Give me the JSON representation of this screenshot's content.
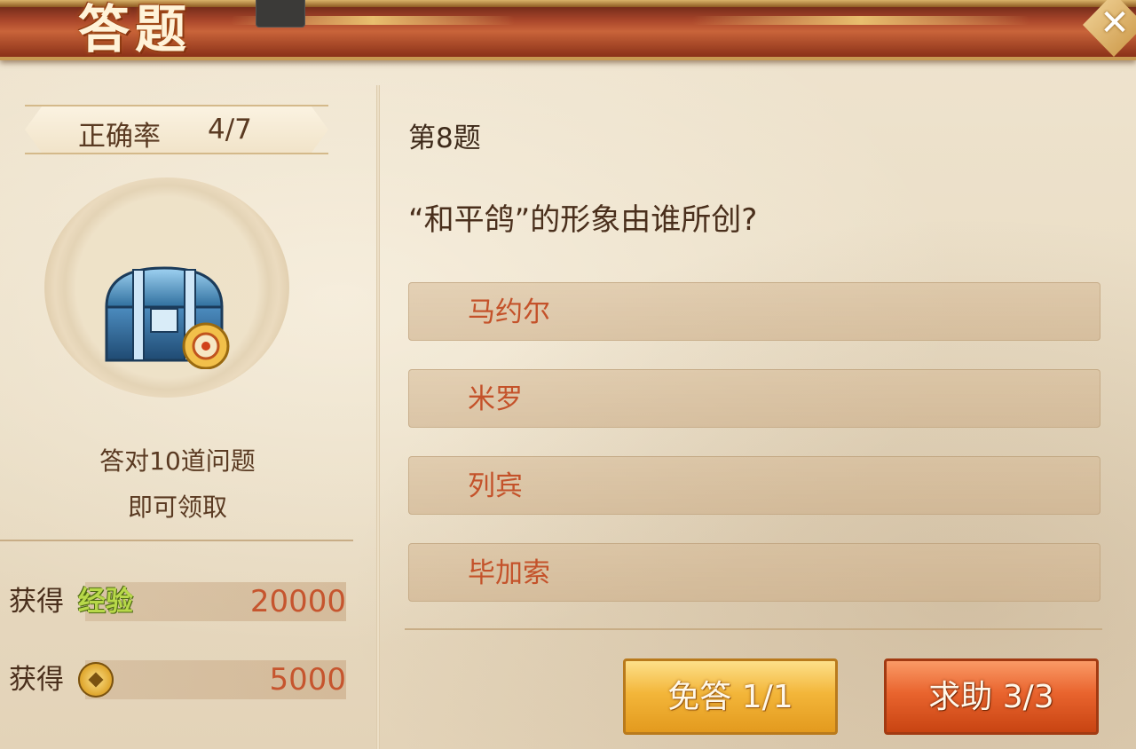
{
  "header": {
    "title": "答题",
    "close_icon": "close-icon"
  },
  "progress": {
    "label": "正确率",
    "value": "4/7"
  },
  "reward": {
    "chest_icon": "treasure-chest-icon",
    "line1": "答对10道问题",
    "line2": "即可领取"
  },
  "gains": [
    {
      "label": "获得",
      "type": "经验",
      "value": "20000"
    },
    {
      "label": "获得",
      "type_icon": "coin-icon",
      "value": "5000"
    }
  ],
  "question": {
    "number": "第8题",
    "text": "“和平鸽”的形象由谁所创?",
    "options": [
      "马约尔",
      "米罗",
      "列宾",
      "毕加索"
    ]
  },
  "actions": {
    "skip": "免答 1/1",
    "help": "求助 3/3"
  },
  "colors": {
    "accent_orange": "#c4522a",
    "exp_green": "#b8d84a",
    "skip_gold": "#f3b63a",
    "help_red": "#e9642e"
  }
}
